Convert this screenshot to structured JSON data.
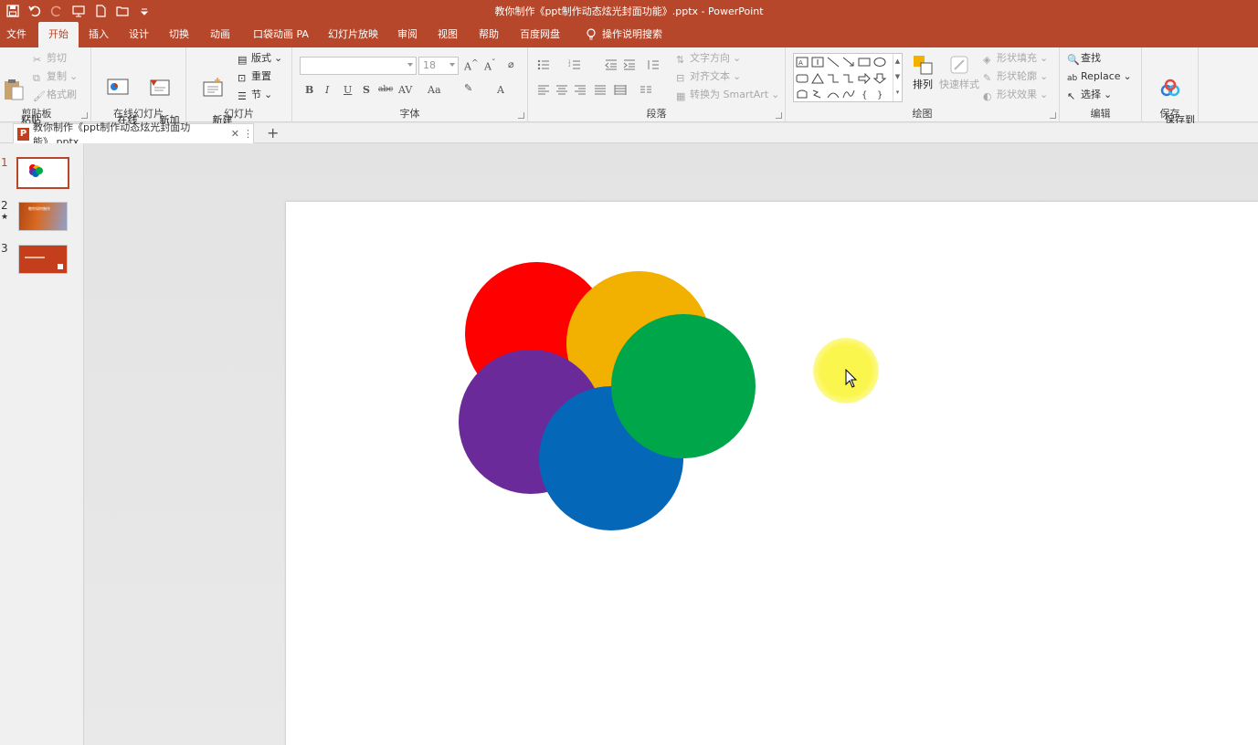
{
  "window": {
    "title": "教你制作《ppt制作动态炫光封面功能》.pptx  -  PowerPoint"
  },
  "ribbon_tabs": [
    {
      "label": "文件"
    },
    {
      "label": "开始"
    },
    {
      "label": "插入"
    },
    {
      "label": "设计"
    },
    {
      "label": "切换"
    },
    {
      "label": "动画"
    },
    {
      "label": "口袋动画 PA"
    },
    {
      "label": "幻灯片放映"
    },
    {
      "label": "审阅"
    },
    {
      "label": "视图"
    },
    {
      "label": "帮助"
    },
    {
      "label": "百度网盘"
    },
    {
      "label": "操作说明搜索"
    }
  ],
  "active_tab": "开始",
  "clipboard": {
    "group": "剪贴板",
    "paste": "粘贴",
    "cut": "剪切",
    "copy": "复制",
    "format_painter": "格式刷"
  },
  "online_slides": {
    "group": "在线幻灯片",
    "online": "在线\n幻灯片",
    "new_anim": "新加\n动画页"
  },
  "slides_group": {
    "group": "幻灯片",
    "new_slide": "新建\n幻灯片",
    "layout": "版式",
    "reset": "重置",
    "section": "节"
  },
  "font": {
    "group": "字体",
    "font_name": "",
    "font_size": "18",
    "bold": "B",
    "italic": "I",
    "underline": "U",
    "shadow": "S",
    "strike": "abc",
    "spacing": "AV",
    "case": "Aa",
    "color": "A"
  },
  "paragraph": {
    "group": "段落",
    "text_direction": "文字方向",
    "align_text": "对齐文本",
    "smartart": "转换为 SmartArt"
  },
  "drawing": {
    "group": "绘图",
    "arrange": "排列",
    "quick_styles": "快速样式",
    "shape_fill": "形状填充",
    "shape_outline": "形状轮廓",
    "shape_effects": "形状效果"
  },
  "editing": {
    "group": "编辑",
    "find": "查找",
    "replace": "Replace",
    "select": "选择"
  },
  "save_group": {
    "group": "保存",
    "save_baidu": "保存到\n百度网盘"
  },
  "file_tab": {
    "name": "教你制作《ppt制作动态炫光封面功能》.pptx",
    "close": "✕",
    "more": "⋮",
    "add": "+"
  },
  "thumbnails": [
    {
      "number": "1",
      "star": ""
    },
    {
      "number": "2",
      "star": "★"
    },
    {
      "number": "3",
      "star": ""
    }
  ],
  "thumb2_text": "教你如何制作",
  "slide": {
    "circles": [
      {
        "name": "red-circle",
        "color": "#ff0000"
      },
      {
        "name": "orange-circle",
        "color": "#f2b000"
      },
      {
        "name": "purple-circle",
        "color": "#6b2a9a"
      },
      {
        "name": "blue-circle",
        "color": "#0567b8"
      },
      {
        "name": "green-circle",
        "color": "#00a64a"
      }
    ],
    "cursor_highlight_color": "#fbf64e"
  },
  "colors": {
    "accent": "#b7472a",
    "ribbon_bg": "#f3f3f3"
  }
}
